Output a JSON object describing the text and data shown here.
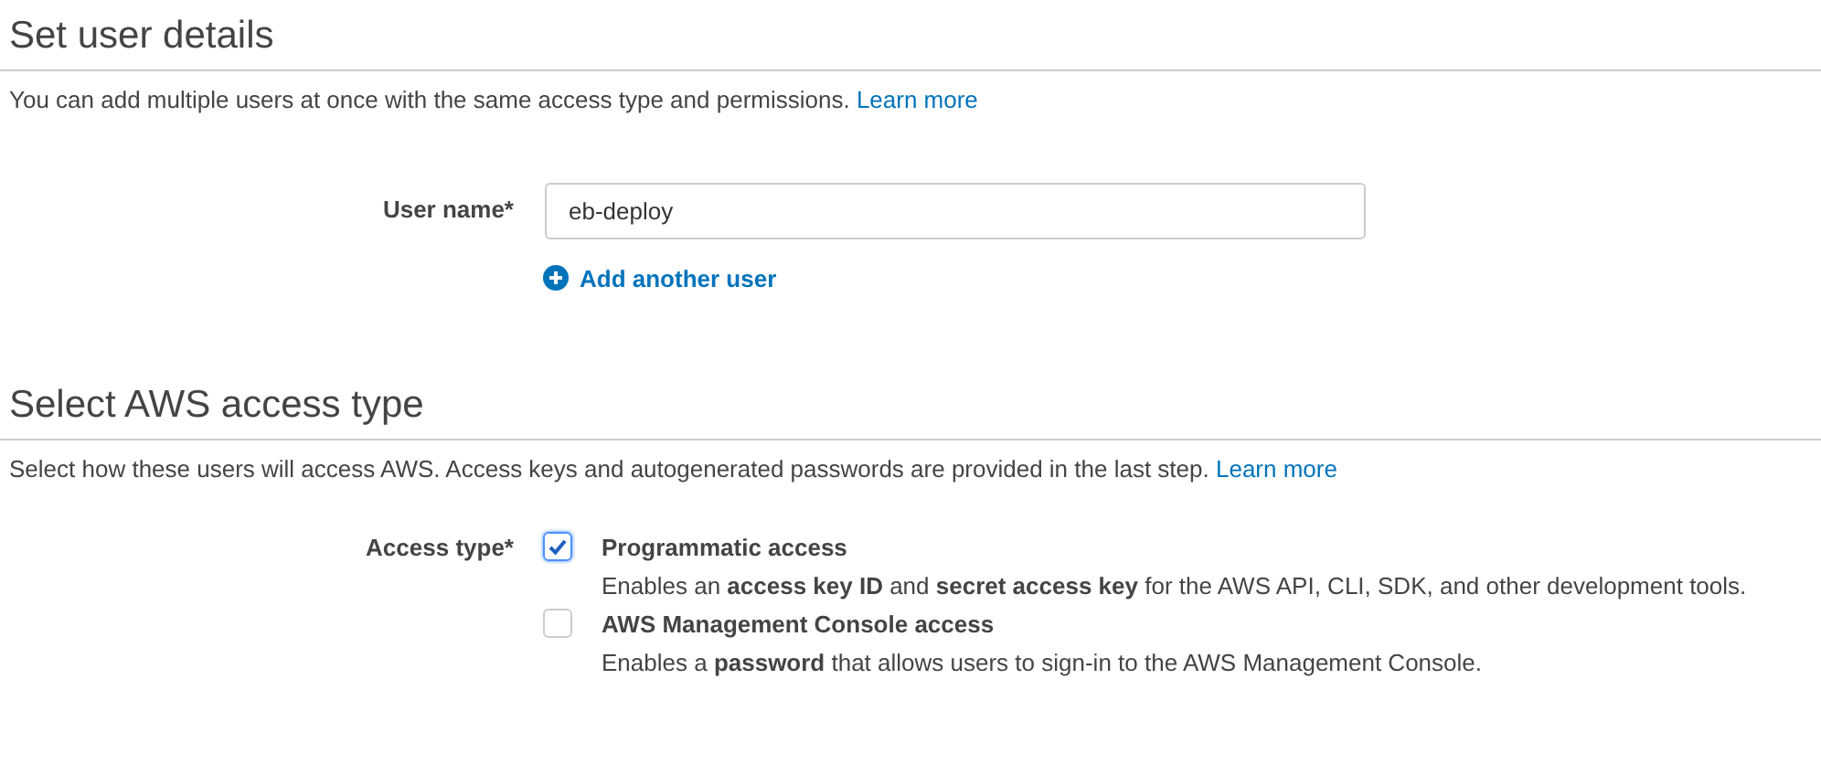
{
  "sections": [
    {
      "title": "Set user details",
      "description": "You can add multiple users at once with the same access type and permissions.",
      "link": "Learn more"
    },
    {
      "title": "Select AWS access type",
      "description": "Select how these users will access AWS. Access keys and autogenerated passwords are provided in the last step.",
      "link": "Learn more"
    }
  ],
  "user_name": {
    "label": "User name*",
    "value": "eb-deploy",
    "add_link": "Add another user"
  },
  "access_type": {
    "label": "Access type*",
    "options": [
      {
        "label": "Programmatic access",
        "description": "Enables an **access key ID** and **secret access key** for the AWS API, CLI, SDK, and other development tools.",
        "checked": true
      },
      {
        "label": "AWS Management Console access",
        "description": "Enables a **password** that allows users to sign-in to the AWS Management Console.",
        "checked": false
      }
    ]
  }
}
